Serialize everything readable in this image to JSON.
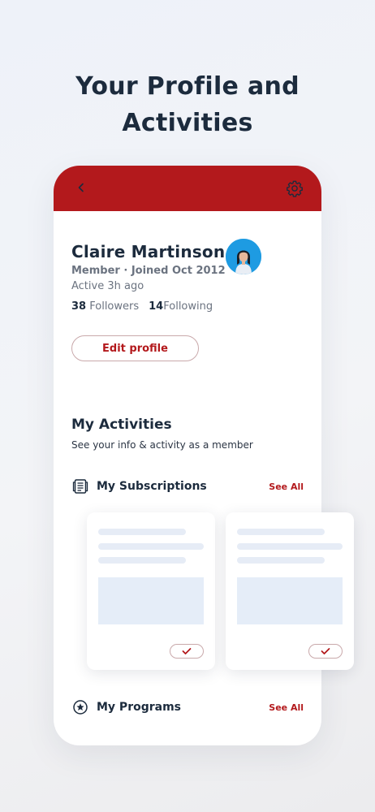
{
  "headline": {
    "line1": "Your Profile and",
    "line2": "Activities"
  },
  "header": {
    "back_icon": "chevron-left-icon",
    "settings_icon": "gear-icon",
    "color": "#b3191c"
  },
  "profile": {
    "name": "Claire Martinson",
    "meta": "Member · Joined Oct 2012",
    "active": "Active 3h ago",
    "followers_count": "38",
    "followers_label": "Followers",
    "following_count": "14",
    "following_label": "Following",
    "edit_label": "Edit profile"
  },
  "activities": {
    "title": "My Activities",
    "subtitle": "See your info & activity as a member",
    "subscriptions": {
      "label": "My Subscriptions",
      "see_all": "See All",
      "icon": "newspaper-icon"
    },
    "programs": {
      "label": "My Programs",
      "see_all": "See All",
      "icon": "star-circle-icon"
    }
  }
}
